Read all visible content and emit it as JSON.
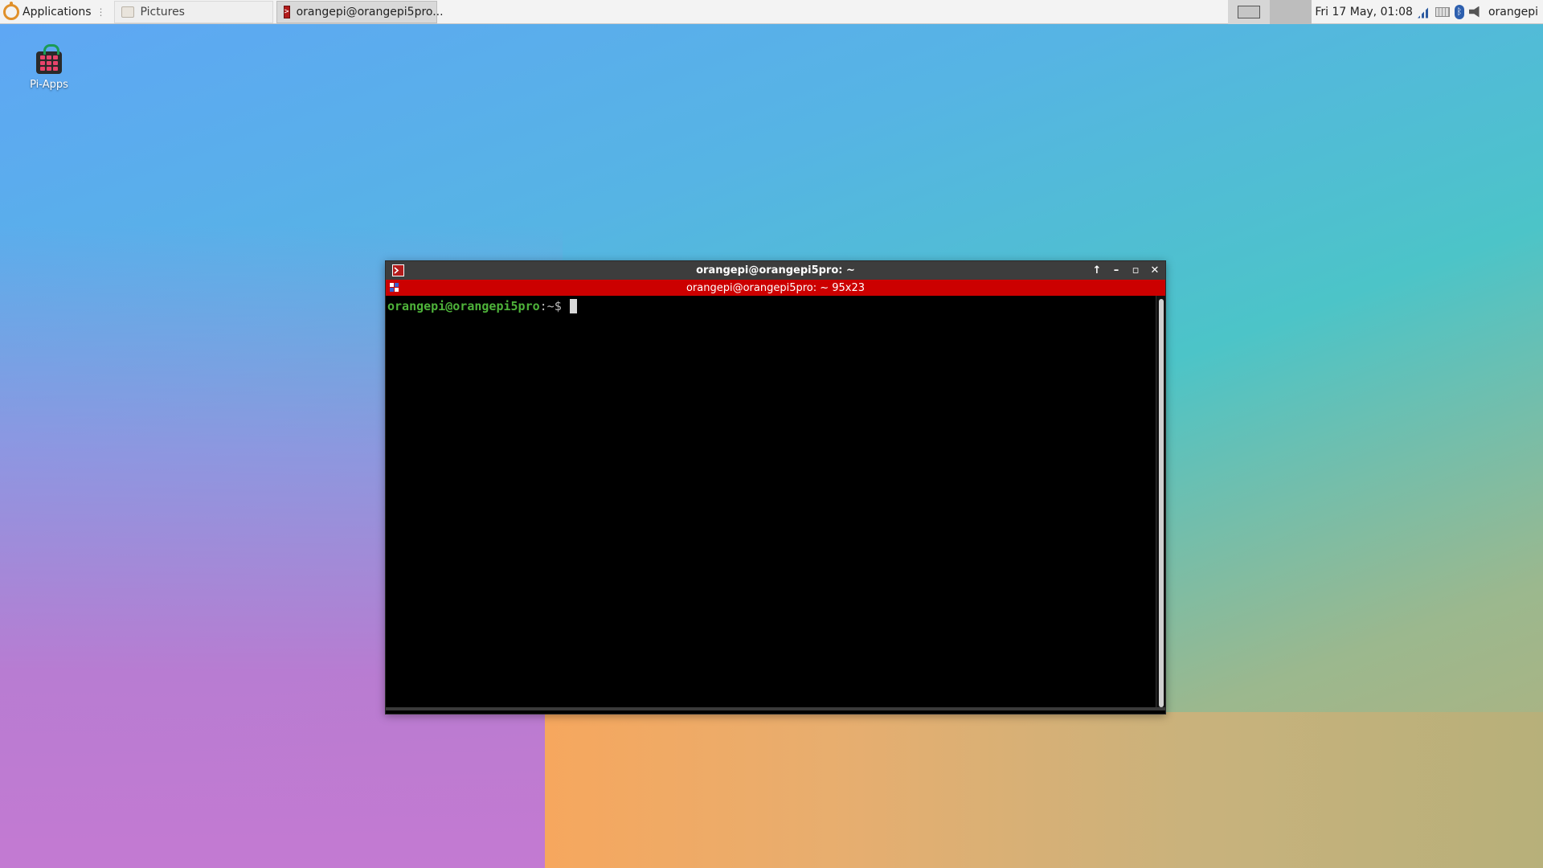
{
  "panel": {
    "applications_label": "Applications",
    "menu_separator": "⋮",
    "tasks": [
      {
        "label": "Pictures",
        "icon": "folder-icon"
      },
      {
        "label": "orangepi@orangepi5pro...",
        "icon": "terminal-icon"
      }
    ],
    "clock": "Fri 17 May, 01:08",
    "user": "orangepi",
    "tray_icons": [
      "network-icon",
      "keyboard-icon",
      "bluetooth-icon",
      "volume-icon"
    ]
  },
  "desktop": {
    "icons": [
      {
        "label": "Pi-Apps",
        "icon": "pi-apps-icon"
      }
    ]
  },
  "terminal": {
    "window_title": "orangepi@orangepi5pro: ~",
    "tab_title": "orangepi@orangepi5pro: ~ 95x23",
    "prompt_user_host": "orangepi@orangepi5pro",
    "prompt_path": ":~$ ",
    "colors": {
      "tab_bar": "#cc0000",
      "prompt_user": "#4eb33a",
      "background": "#000000"
    }
  }
}
